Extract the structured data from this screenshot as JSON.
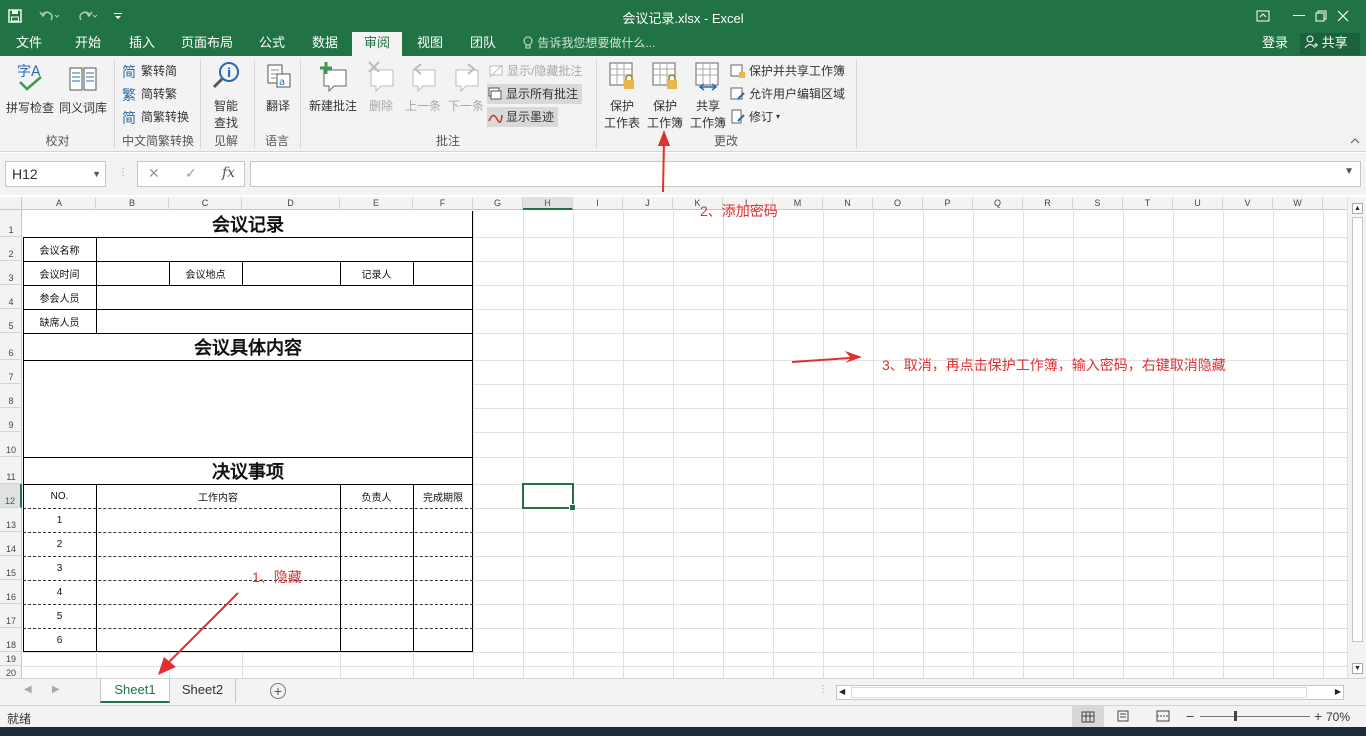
{
  "app": {
    "title": "会议记录.xlsx - Excel",
    "accent_color": "#217346"
  },
  "quick_access": {
    "icons": [
      "save-icon",
      "undo-icon",
      "redo-icon",
      "customize-icon"
    ]
  },
  "window_controls": {
    "icons": [
      "ribbon-display-icon",
      "minimize-icon",
      "restore-icon",
      "close-icon"
    ]
  },
  "tabs": [
    {
      "label": "文件"
    },
    {
      "label": "开始"
    },
    {
      "label": "插入"
    },
    {
      "label": "页面布局"
    },
    {
      "label": "公式"
    },
    {
      "label": "数据"
    },
    {
      "label": "审阅"
    },
    {
      "label": "视图"
    },
    {
      "label": "团队"
    }
  ],
  "active_tab": "审阅",
  "tellme_placeholder": "告诉我您想要做什么...",
  "login_label": "登录",
  "share_label": "共享",
  "ribbon": {
    "groups": [
      {
        "label": "校对"
      },
      {
        "label": "中文简繁转换"
      },
      {
        "label": "见解"
      },
      {
        "label": "语言"
      },
      {
        "label": "批注"
      },
      {
        "label": "更改"
      }
    ],
    "spell_check": "拼写检查",
    "thesaurus": "同义词库",
    "to_simplified": "繁转简",
    "to_traditional": "简转繁",
    "convert": "简繁转换",
    "smart_lookup_1": "智能",
    "smart_lookup_2": "查找",
    "translate": "翻译",
    "new_comment": "新建批注",
    "delete": "删除",
    "prev": "上一条",
    "next": "下一条",
    "show_hide_comment": "显示/隐藏批注",
    "show_all_comments": "显示所有批注",
    "show_ink": "显示墨迹",
    "protect_sheet_1": "保护",
    "protect_sheet_2": "工作表",
    "protect_workbook_1": "保护",
    "protect_workbook_2": "工作簿",
    "share_workbook_1": "共享",
    "share_workbook_2": "工作簿",
    "protect_share": "保护并共享工作簿",
    "allow_edit_ranges": "允许用户编辑区域",
    "track_changes": "修订"
  },
  "formula_bar": {
    "name_box": "H12",
    "fx": "fx",
    "value": ""
  },
  "columns": [
    "A",
    "B",
    "C",
    "D",
    "E",
    "F",
    "G",
    "H",
    "I",
    "J",
    "K",
    "L",
    "M",
    "N",
    "O",
    "P",
    "Q",
    "R",
    "S",
    "T",
    "U",
    "V",
    "W"
  ],
  "selected_column": "H",
  "rows": [
    "1",
    "2",
    "3",
    "4",
    "5",
    "6",
    "7",
    "8",
    "9",
    "10",
    "11",
    "12",
    "13",
    "14",
    "15",
    "16",
    "17",
    "18",
    "19",
    "20"
  ],
  "selected_row": "12",
  "form": {
    "title": "会议记录",
    "meeting_name": "会议名称",
    "meeting_time": "会议时间",
    "meeting_place": "会议地点",
    "recorder": "记录人",
    "attendees": "参会人员",
    "absentees": "缺席人员",
    "content_title": "会议具体内容",
    "decisions_title": "决议事项",
    "col_no": "NO.",
    "col_work": "工作内容",
    "col_owner": "负责人",
    "col_deadline": "完成期限",
    "items": [
      "1",
      "2",
      "3",
      "4",
      "5",
      "6"
    ]
  },
  "annotations": {
    "a1": "1、隐藏",
    "a2": "2、添加密码",
    "a3": "3、取消，再点击保护工作簿，输入密码，右键取消隐藏",
    "color": "#e03030"
  },
  "sheets": [
    {
      "name": "Sheet1"
    },
    {
      "name": "Sheet2"
    }
  ],
  "active_sheet": "Sheet1",
  "status": {
    "ready": "就绪",
    "zoom": "70%"
  }
}
